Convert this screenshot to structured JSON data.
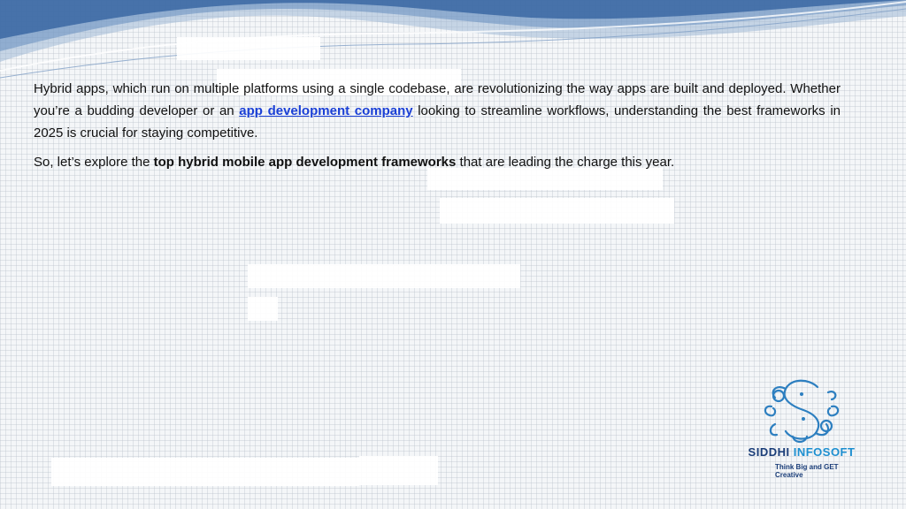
{
  "content": {
    "para1_start": "Hybrid apps, which run on multiple platforms using a single codebase, are revolutionizing the way apps are built and deployed. Whether you’re a budding developer or an ",
    "link_text": "app development company",
    "para1_end": " looking to streamline workflows, understanding the best frameworks in 2025 is crucial for staying competitive.",
    "para2_start": "So, let’s explore the ",
    "para2_bold": "top hybrid mobile app development frameworks",
    "para2_end": " that are leading the charge this year."
  },
  "logo": {
    "name_part1": "SIDDHI ",
    "name_part2": "INFOSOFT",
    "tagline": "Think Big and GET Creative"
  },
  "colors": {
    "link": "#1a3fd6",
    "brand_dark": "#1a3d78",
    "brand_light": "#1d8fd0"
  }
}
